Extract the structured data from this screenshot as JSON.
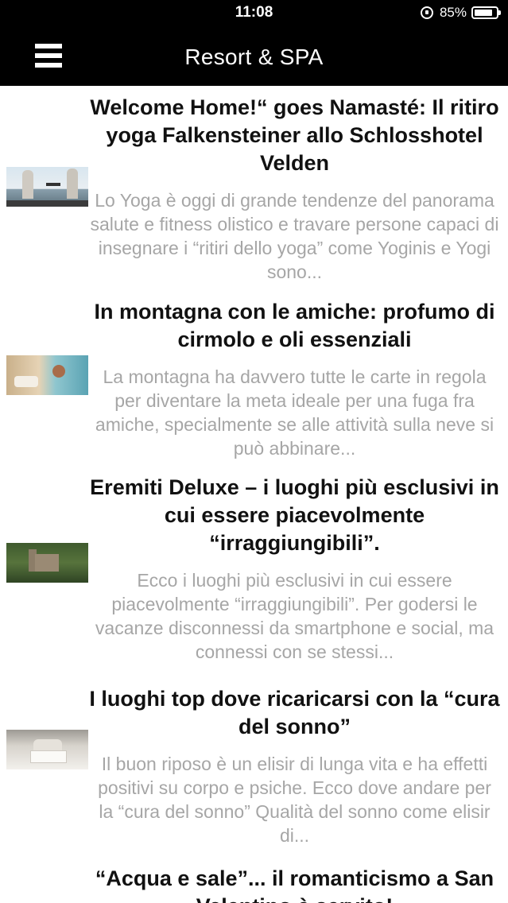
{
  "status_bar": {
    "time": "11:08",
    "battery_percent": "85%",
    "battery_level": 0.85,
    "icons": [
      "rotation-lock-icon",
      "battery-icon"
    ]
  },
  "nav": {
    "title": "Resort & SPA",
    "menu_icon": "hamburger-menu-icon"
  },
  "articles": [
    {
      "title": "Welcome Home!“ goes Namasté: Il ritiro yoga Falkensteiner allo Schlosshotel Velden",
      "excerpt": "Lo Yoga è oggi di grande tendenze del panorama salute e fitness olistico e travare persone capaci di insegnare i “ritiri dello yoga” come Yoginis e Yogi sono..."
    },
    {
      "title": "In montagna con le amiche: profumo di cirmolo e oli essenziali",
      "excerpt": "La montagna ha davvero tutte le carte in regola per diventare la meta ideale per una fuga fra amiche, specialmente se alle attività sulla neve si può abbinare..."
    },
    {
      "title": "Eremiti Deluxe – i luoghi più esclusivi in cui essere piacevolmente “irraggiungibili”.",
      "excerpt": "Ecco i luoghi più esclusivi in cui essere piacevolmente “irraggiungibili”. Per godersi le vacanze disconnessi da smartphone e social, ma connessi con se stessi..."
    },
    {
      "title": "I luoghi top dove ricaricarsi con la “cura del sonno”",
      "excerpt": "Il buon riposo è un elisir di lunga vita e ha effetti positivi su corpo e psiche. Ecco dove andare per la “cura del sonno” Qualità del sonno come elisir di..."
    },
    {
      "title": "“Acqua e sale”... il romanticismo a San Valentino è servito!",
      "excerpt": ""
    }
  ]
}
